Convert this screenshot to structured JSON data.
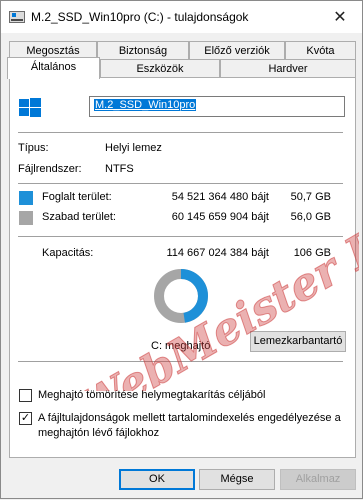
{
  "window": {
    "title": "M.2_SSD_Win10pro (C:) - tulajdonságok",
    "close_glyph": "✕"
  },
  "tabs": {
    "row1": [
      "Megosztás",
      "Biztonság",
      "Előző verziók",
      "Kvóta"
    ],
    "row2": [
      "Általános",
      "Eszközök",
      "Hardver"
    ],
    "active": "Általános"
  },
  "general": {
    "volume_name": "M.2_SSD_Win10pro",
    "type_label": "Típus:",
    "type_value": "Helyi lemez",
    "fs_label": "Fájlrendszer:",
    "fs_value": "NTFS",
    "used_label": "Foglalt terület:",
    "used_bytes": "54 521 364 480 bájt",
    "used_gb": "50,7 GB",
    "free_label": "Szabad terület:",
    "free_bytes": "60 145 659 904 bájt",
    "free_gb": "56,0 GB",
    "capacity_label": "Kapacitás:",
    "capacity_bytes": "114 667 024 384 bájt",
    "capacity_gb": "106 GB",
    "drive_label": "C: meghajtó",
    "cleanup_button": "Lemezkarbantartó",
    "compress_label": "Meghajtó tömörítése helymegtakarítás céljából",
    "compress_checked": false,
    "index_label_line1": "A fájltulajdonságok mellett tartalomindexelés engedélyezése a",
    "index_label_line2": "meghajtón lévő fájlokhoz",
    "index_checked": true,
    "used_fraction": 0.4755
  },
  "buttons": {
    "ok": "OK",
    "cancel": "Mégse",
    "apply": "Alkalmaz"
  },
  "watermark": "WebMeister KE",
  "colors": {
    "used": "#1e90d8",
    "free": "#a6a6a6",
    "selection": "#0078d7",
    "watermark": "#cc3b3b"
  }
}
